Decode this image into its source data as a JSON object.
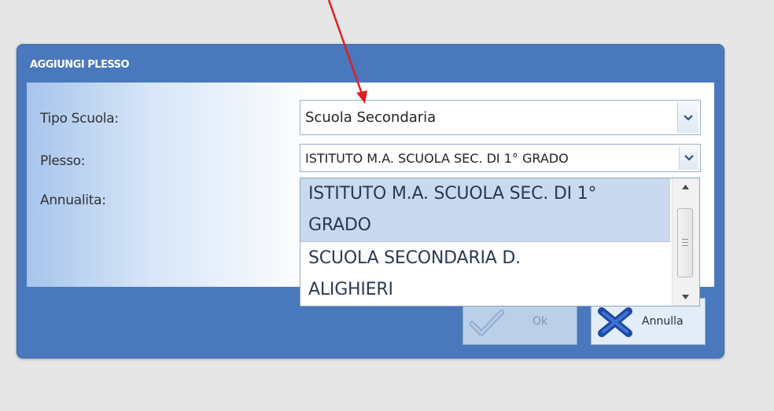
{
  "dialog": {
    "title": "AGGIUNGI PLESSO",
    "tipo_scuola_label": "Tipo Scuola:",
    "tipo_scuola_value": "Scuola Secondaria",
    "plesso_label": "Plesso:",
    "plesso_value": "ISTITUTO M.A. SCUOLA SEC. DI 1° GRADO",
    "annualita_label": "Annualita:"
  },
  "dropdown": {
    "options": [
      {
        "line1": "ISTITUTO M.A. SCUOLA SEC. DI 1°",
        "line2": "GRADO",
        "selected": true
      },
      {
        "line1": "SCUOLA SECONDARIA D.",
        "line2": "ALIGHIERI",
        "selected": false
      }
    ]
  },
  "buttons": {
    "ok_label": "Ok",
    "cancel_label": "Annulla"
  },
  "colors": {
    "dialog_bg": "#4a78bd",
    "arrow": "#e02020",
    "selected_option": "#cbd9ee"
  },
  "icons": [
    "chevron-down-icon",
    "checkmark-icon",
    "close-x-icon",
    "scroll-up-icon",
    "scroll-down-icon"
  ]
}
